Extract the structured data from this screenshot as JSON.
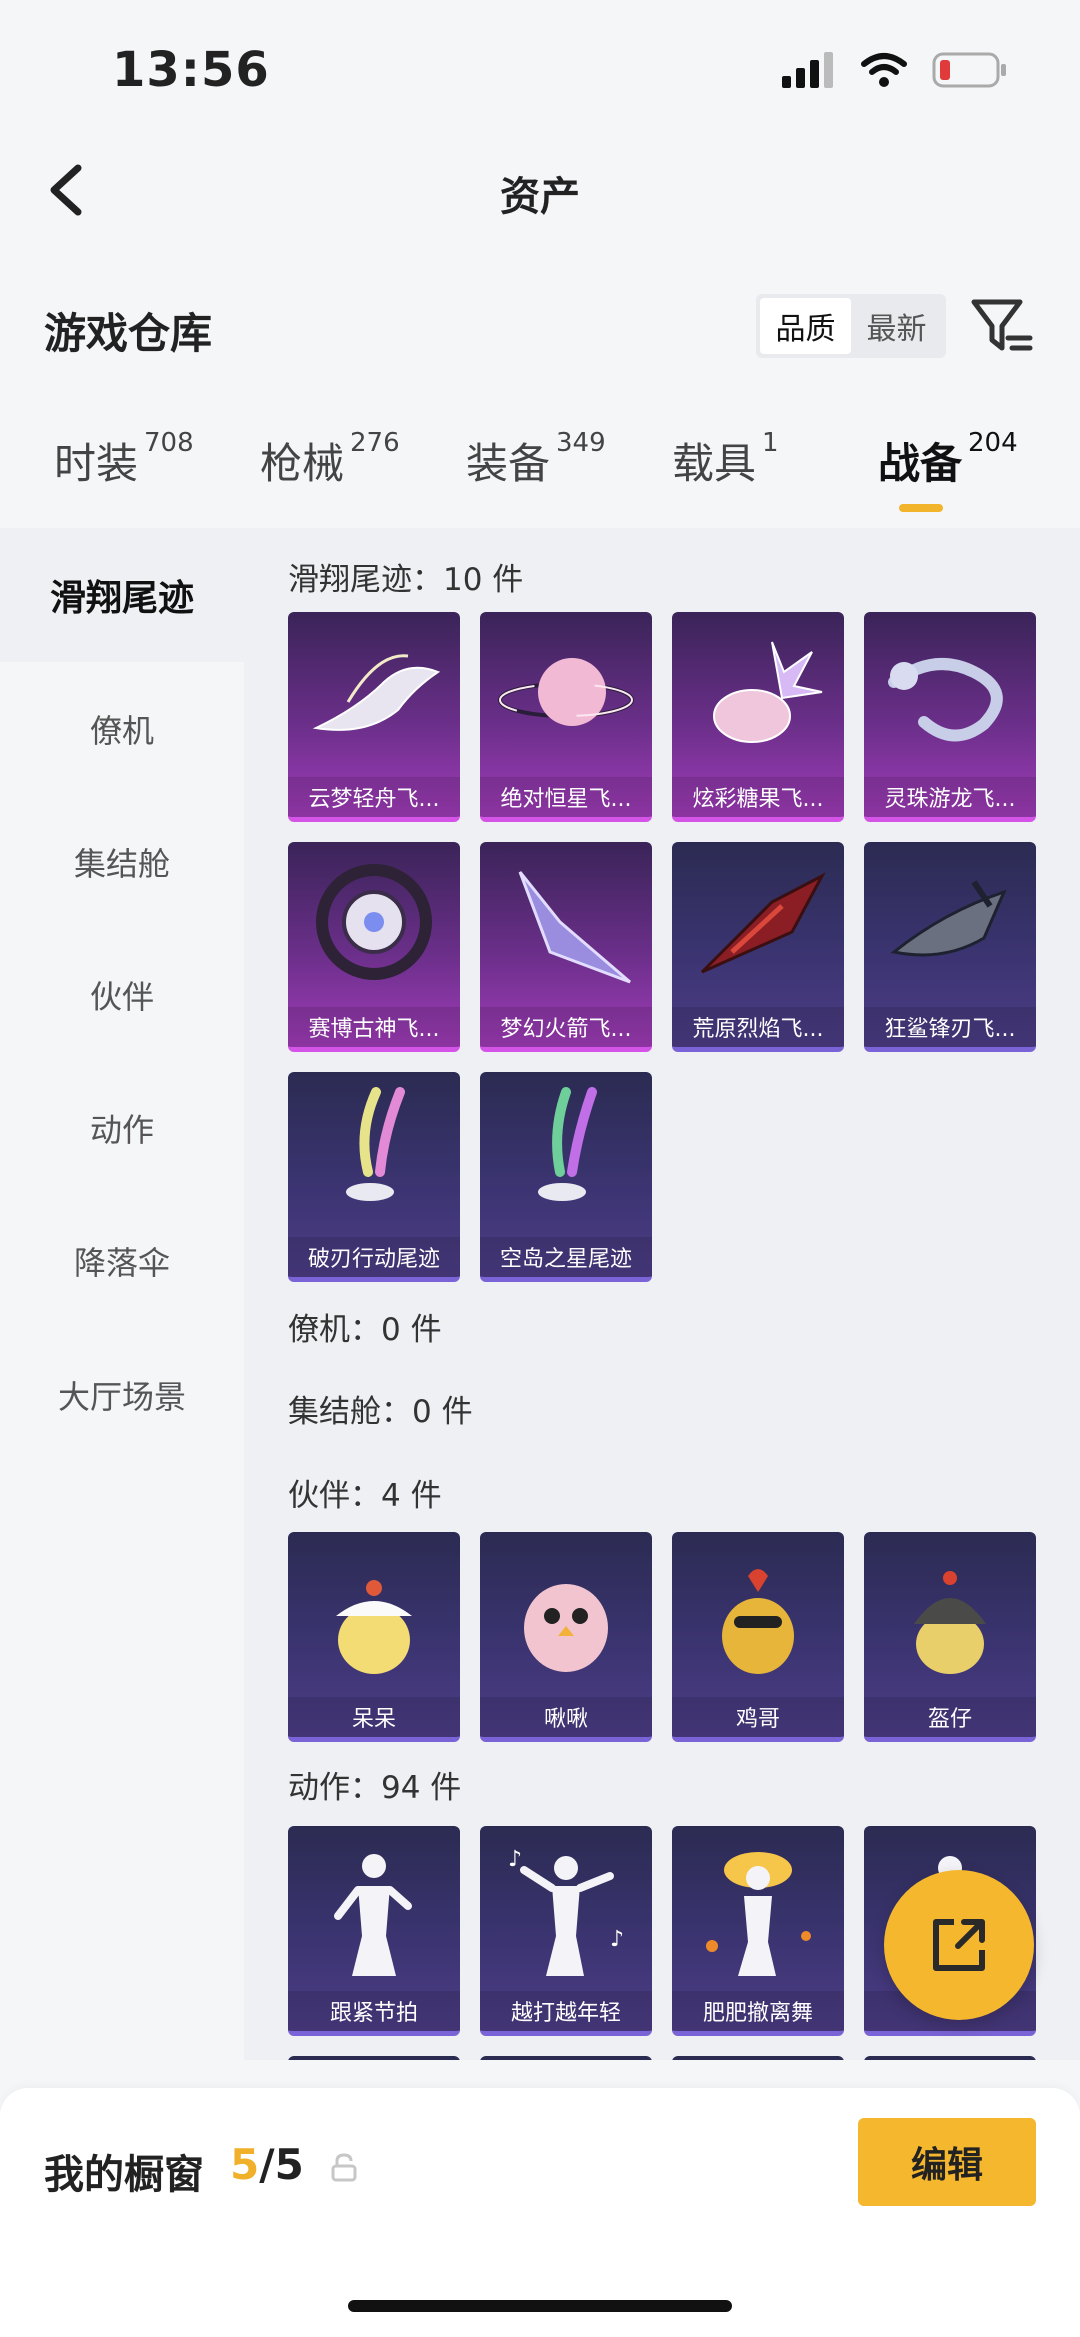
{
  "status": {
    "time": "13:56"
  },
  "header": {
    "title": "资产"
  },
  "warehouse": {
    "title": "游戏仓库",
    "sort_options": [
      "品质",
      "最新"
    ],
    "active_sort": "品质"
  },
  "tabs": [
    {
      "label": "时装",
      "count": "708"
    },
    {
      "label": "枪械",
      "count": "276"
    },
    {
      "label": "装备",
      "count": "349"
    },
    {
      "label": "载具",
      "count": "1"
    },
    {
      "label": "战备",
      "count": "204"
    }
  ],
  "active_tab": "战备",
  "sidebar": [
    "滑翔尾迹",
    "僚机",
    "集结舱",
    "伙伴",
    "动作",
    "降落伞",
    "大厅场景"
  ],
  "active_sidebar": "滑翔尾迹",
  "sections": {
    "trails": {
      "title": "滑翔尾迹：10 件",
      "items": [
        "云梦轻舟飞...",
        "绝对恒星飞...",
        "炫彩糖果飞...",
        "灵珠游龙飞...",
        "赛博古神飞...",
        "梦幻火箭飞...",
        "荒原烈焰飞...",
        "狂鲨锋刃飞...",
        "破刃行动尾迹",
        "空岛之星尾迹"
      ]
    },
    "wingman": {
      "title": "僚机：0 件"
    },
    "pod": {
      "title": "集结舱：0 件"
    },
    "partners": {
      "title": "伙伴：4 件",
      "items": [
        "呆呆",
        "啾啾",
        "鸡哥",
        "盔仔"
      ]
    },
    "actions": {
      "title": "动作：94 件",
      "items": [
        "跟紧节拍",
        "越打越年轻",
        "肥肥撤离舞",
        ""
      ]
    }
  },
  "showcase": {
    "label": "我的橱窗",
    "current": "5",
    "total": "/5",
    "edit_label": "编辑"
  },
  "colors": {
    "accent": "#f4b72d",
    "card_blue": "#3b3471",
    "card_purple": "#6b2f8a"
  }
}
